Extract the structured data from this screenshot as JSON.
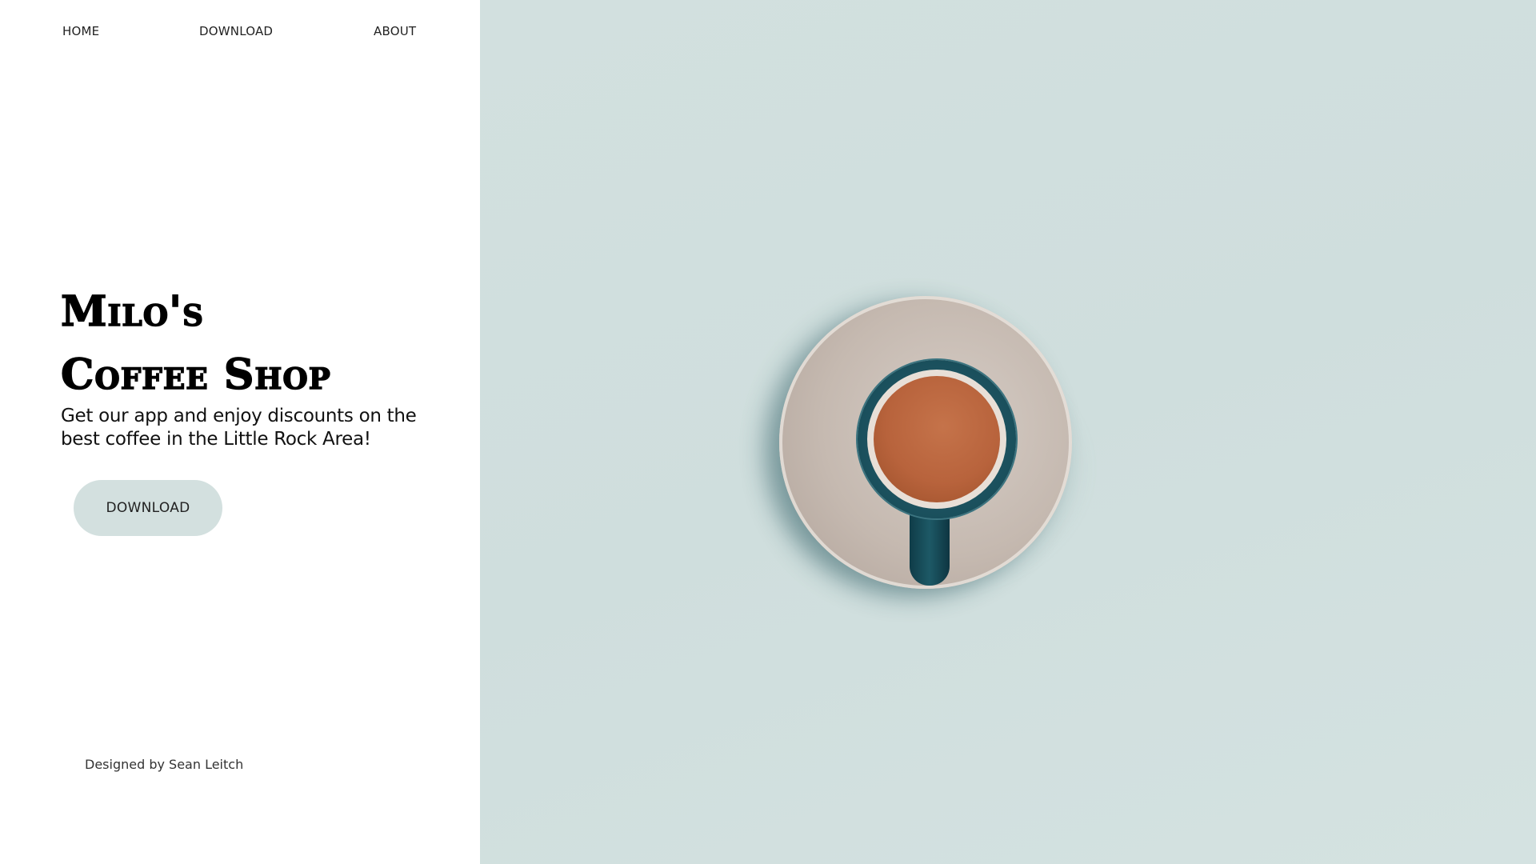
{
  "nav": {
    "home_label": "HOME",
    "download_label": "DOWNLOAD",
    "about_label": "ABOUT"
  },
  "hero": {
    "title_line1": "Milo's",
    "title_line2": "Coffee Shop",
    "subtitle": "Get our app and enjoy discounts on the best coffee in the Little Rock Area!",
    "button_label": "DOWNLOAD"
  },
  "footer": {
    "credit": "Designed by Sean Leitch"
  },
  "colors": {
    "background_right": "#d2e0df",
    "button_background": "#d3e0df",
    "text": "#000000",
    "coffee": "#b8633c",
    "cup": "#1a4f5c",
    "saucer": "#c5b9b0"
  },
  "hero_image": {
    "icon": "coffee-cup-top-view"
  }
}
